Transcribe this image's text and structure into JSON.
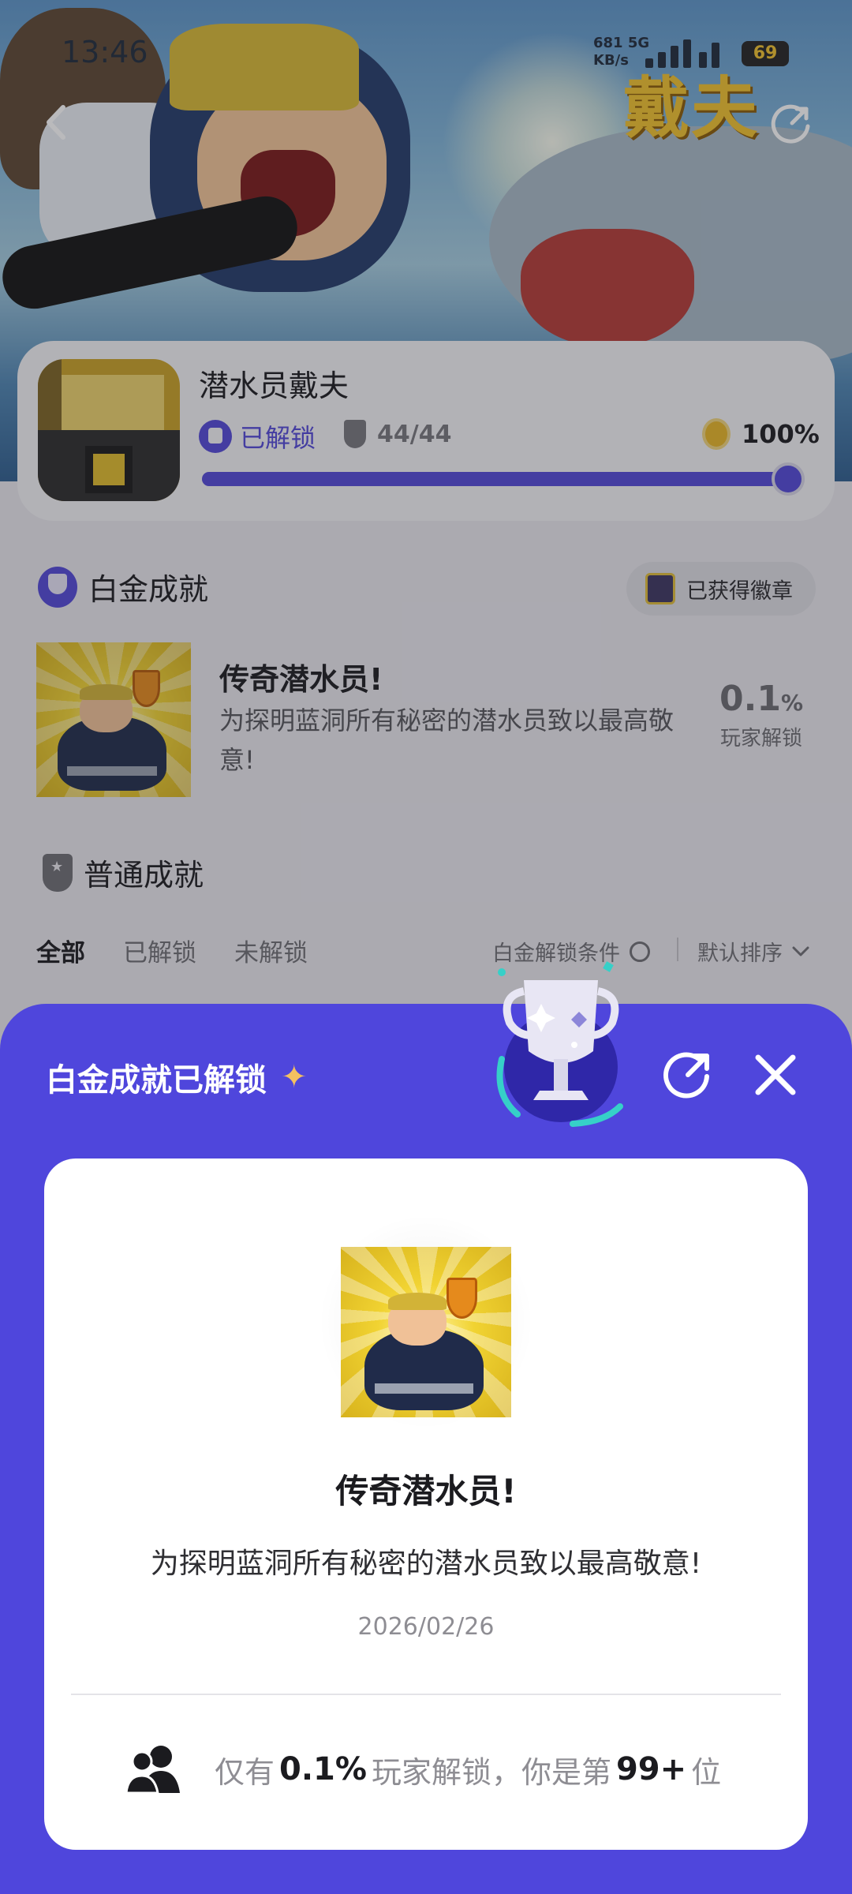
{
  "status_bar": {
    "time": "13:46",
    "net_speed": "681",
    "net_unit": "KB/s",
    "net_type": "5G",
    "battery": "69"
  },
  "banner": {
    "logo_text": "戴夫"
  },
  "game": {
    "name": "潜水员戴夫",
    "unlock_label": "已解锁",
    "trophy_count": "44/44",
    "completion": "100%",
    "progress_fraction": 1.0
  },
  "platinum_section": {
    "title": "白金成就",
    "badge_label": "已获得徽章",
    "achievement": {
      "title": "传奇潜水员!",
      "description": "为探明蓝洞所有秘密的潜水员致以最高敬意!",
      "rate_value": "0.1",
      "rate_unit": "%",
      "rate_label": "玩家解锁"
    }
  },
  "normal_section": {
    "title": "普通成就",
    "filters": [
      "全部",
      "已解锁",
      "未解锁"
    ],
    "active_filter": "全部",
    "condition_label": "白金解锁条件",
    "sort_label": "默认排序"
  },
  "popup": {
    "title": "白金成就已解锁",
    "achievement_title": "传奇潜水员!",
    "achievement_desc": "为探明蓝洞所有秘密的潜水员致以最高敬意!",
    "date": "2026/02/26",
    "stat_prefix": "仅有",
    "stat_pct": "0.1%",
    "stat_middle": "玩家解锁，你是第",
    "stat_rank": "99+",
    "stat_suffix": "位"
  },
  "colors": {
    "accent": "#4f46dc",
    "platinum_purple": "#5148d8",
    "gold": "#e7b526"
  },
  "icons": [
    "back-icon",
    "share-icon",
    "unlock-icon",
    "trophy-icon",
    "medal-icon",
    "platinum-trophy-icon",
    "badge-icon",
    "normal-trophy-icon",
    "info-circle-icon",
    "chevron-down-icon",
    "sparkle-icon",
    "close-icon",
    "users-icon"
  ]
}
